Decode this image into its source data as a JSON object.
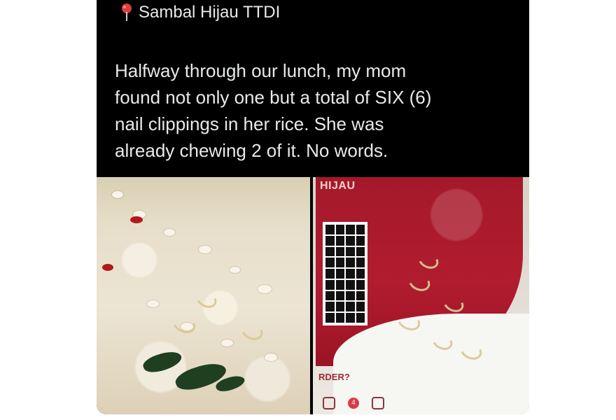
{
  "tweet": {
    "location": "Sambal Hijau TTDI",
    "text": "Halfway through our lunch, my mom\nfound not only one but a total of SIX (6)\nnail clippings in her rice. She was\nalready chewing 2 of it. No words.",
    "media_left_alt": "rice-plate-photo",
    "media_right_alt": "red-plate-photo",
    "brand_label": "HIJAU",
    "order_label": "RDER?",
    "badge_count": "4"
  },
  "colors": {
    "background": "#ffffff",
    "card": "#000000",
    "text": "#e7e9ea",
    "accent": "#b11c2f"
  }
}
